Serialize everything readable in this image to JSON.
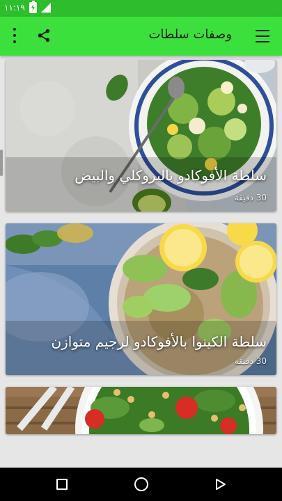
{
  "status_bar": {
    "time": "١١:١٩"
  },
  "app_bar": {
    "title": "وصفات سلطات"
  },
  "recipes": [
    {
      "title": "سلطة الأفوكادو بالبروكلي والبيض",
      "time": "30 دقيقة"
    },
    {
      "title": "سلطة الكينوا بالأفوكادو لرجيم متوازن",
      "time": "30 دقيقة"
    },
    {
      "title": "",
      "time": ""
    }
  ],
  "colors": {
    "status_bar": "#2dbd2d",
    "app_bar": "#3ce03c",
    "nav_bar": "#000000"
  }
}
